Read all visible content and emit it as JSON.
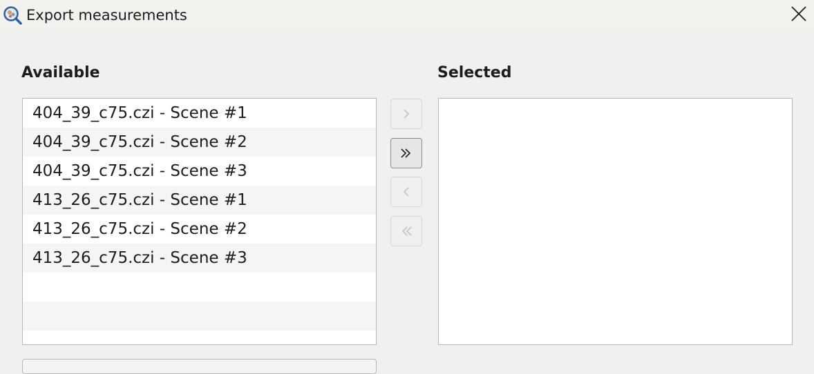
{
  "window": {
    "title": "Export measurements",
    "app_icon": "qupath-magnifier-icon",
    "close_icon": "close-icon"
  },
  "available": {
    "heading": "Available",
    "items": [
      "404_39_c75.czi - Scene #1",
      "404_39_c75.czi - Scene #2",
      "404_39_c75.czi - Scene #3",
      "413_26_c75.czi - Scene #1",
      "413_26_c75.czi - Scene #2",
      "413_26_c75.czi - Scene #3"
    ]
  },
  "selected": {
    "heading": "Selected",
    "items": []
  },
  "move_buttons": {
    "add_one_icon": "chevron-right-icon",
    "add_all_icon": "double-chevron-right-icon",
    "remove_one_icon": "chevron-left-icon",
    "remove_all_icon": "double-chevron-left-icon"
  },
  "colors": {
    "accent_icon_blue": "#2a5ea8",
    "disabled_glyph": "#c4c4c4",
    "enabled_glyph": "#222222"
  }
}
